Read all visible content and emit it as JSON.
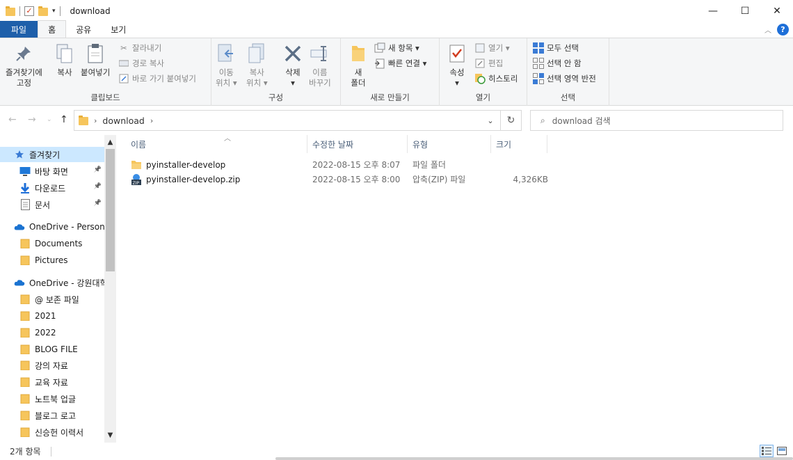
{
  "window": {
    "title": "download",
    "minimize": "—",
    "maximize": "☐",
    "close": "✕"
  },
  "ribbon_tabs": [
    "파일",
    "홈",
    "공유",
    "보기"
  ],
  "ribbon": {
    "clipboard": {
      "pin": "즐겨찾기에\n고정",
      "copy": "복사",
      "paste": "붙여넣기",
      "cut": "잘라내기",
      "copy_path": "경로 복사",
      "paste_shortcut": "바로 가기 붙여넣기",
      "label": "클립보드"
    },
    "organize": {
      "move_to": "이동\n위치 ▾",
      "copy_to": "복사\n위치 ▾",
      "delete": "삭제\n▾",
      "rename": "이름\n바꾸기",
      "label": "구성"
    },
    "new": {
      "new_folder": "새\n폴더",
      "new_item": "새 항목 ▾",
      "easy_access": "빠른 연결 ▾",
      "label": "새로 만들기"
    },
    "open": {
      "properties": "속성\n▾",
      "open": "열기 ▾",
      "edit": "편집",
      "history": "히스토리",
      "label": "열기"
    },
    "select": {
      "select_all": "모두 선택",
      "select_none": "선택 안 함",
      "invert": "선택 영역 반전",
      "label": "선택"
    }
  },
  "address": {
    "path": "download",
    "search_placeholder": "download 검색"
  },
  "nav_pane": [
    {
      "label": "즐겨찾기",
      "icon": "star-icon",
      "pinned": false,
      "selected": true
    },
    {
      "label": "바탕 화면",
      "icon": "desktop-icon",
      "pinned": true,
      "selected": false
    },
    {
      "label": "다운로드",
      "icon": "download-arrow-icon",
      "pinned": true,
      "selected": false
    },
    {
      "label": "문서",
      "icon": "document-icon",
      "pinned": true,
      "selected": false
    },
    {
      "label": "OneDrive - Persona",
      "icon": "cloud-icon",
      "pinned": false,
      "selected": false
    },
    {
      "label": "Documents",
      "icon": "folder-icon",
      "pinned": false,
      "selected": false
    },
    {
      "label": "Pictures",
      "icon": "folder-icon",
      "pinned": false,
      "selected": false
    },
    {
      "label": "OneDrive - 강원대학",
      "icon": "cloud-icon",
      "pinned": false,
      "selected": false
    },
    {
      "label": "@ 보존 파일",
      "icon": "folder-icon",
      "pinned": false,
      "selected": false
    },
    {
      "label": "2021",
      "icon": "folder-icon",
      "pinned": false,
      "selected": false
    },
    {
      "label": "2022",
      "icon": "folder-icon",
      "pinned": false,
      "selected": false
    },
    {
      "label": "BLOG FILE",
      "icon": "folder-icon",
      "pinned": false,
      "selected": false
    },
    {
      "label": "강의 자료",
      "icon": "folder-icon",
      "pinned": false,
      "selected": false
    },
    {
      "label": "교육 자료",
      "icon": "folder-icon",
      "pinned": false,
      "selected": false
    },
    {
      "label": "노트북 업글",
      "icon": "folder-icon",
      "pinned": false,
      "selected": false
    },
    {
      "label": "블로그 로고",
      "icon": "folder-icon",
      "pinned": false,
      "selected": false
    },
    {
      "label": "신승헌 이력서",
      "icon": "folder-icon",
      "pinned": false,
      "selected": false
    }
  ],
  "columns": [
    "이름",
    "수정한 날짜",
    "유형",
    "크기"
  ],
  "files": [
    {
      "name": "pyinstaller-develop",
      "date": "2022-08-15 오후 8:07",
      "type": "파일 폴더",
      "size": "",
      "icon": "folder-icon"
    },
    {
      "name": "pyinstaller-develop.zip",
      "date": "2022-08-15 오후 8:00",
      "type": "압축(ZIP) 파일",
      "size": "4,326KB",
      "icon": "zip-icon"
    }
  ],
  "status": {
    "count": "2개 항목"
  },
  "colors": {
    "file_tab": "#1e5faa",
    "selection": "#cce8ff",
    "folder": "#f6c55c"
  }
}
